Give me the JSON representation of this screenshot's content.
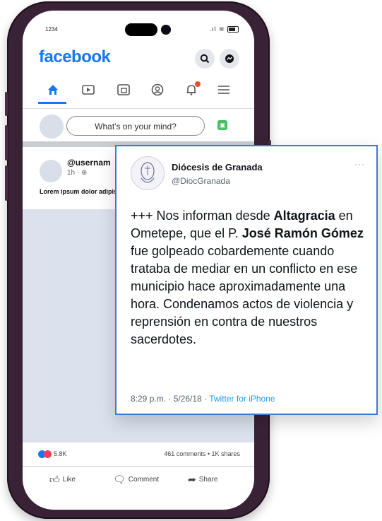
{
  "phone": {
    "status_time": "1234"
  },
  "facebook": {
    "logo": "facebook",
    "header_icons": [
      "search-icon",
      "messenger-icon"
    ],
    "nav_icons": [
      "home-icon",
      "video-icon",
      "marketplace-icon",
      "profile-icon",
      "notifications-icon",
      "menu-icon"
    ],
    "composer_placeholder": "What's on your mind?",
    "post": {
      "username": "@usernam",
      "meta": "1h · ",
      "body": "Lorem ipsum dolor adipiscingelit."
    },
    "stats": {
      "reactions": "5.8K",
      "comments_shares": "461 comments  • 1K shares"
    },
    "actions": {
      "like": "Like",
      "comment": "Comment",
      "share": "Share"
    },
    "colors": {
      "brand": "#1877f2"
    }
  },
  "tweet": {
    "display_name": "Diócesis de Granada",
    "handle": "@DiocGranada",
    "more": "···",
    "text_parts": [
      "+++ Nos informan desde ",
      "Altagracia",
      " en Ometepe, que el P. ",
      "José Ramón Gómez",
      " fue golpeado cobardemente cuando trataba de mediar en un conflicto en ese municipio hace aproximadamente una hora. Condenamos actos de violencia y reprensión en contra de nuestros sacerdotes."
    ],
    "timestamp": "8:29 p.m. · 5/26/18 · ",
    "source": "Twitter for iPhone",
    "colors": {
      "border": "#3b7bd8",
      "link": "#1d9bf0"
    }
  }
}
